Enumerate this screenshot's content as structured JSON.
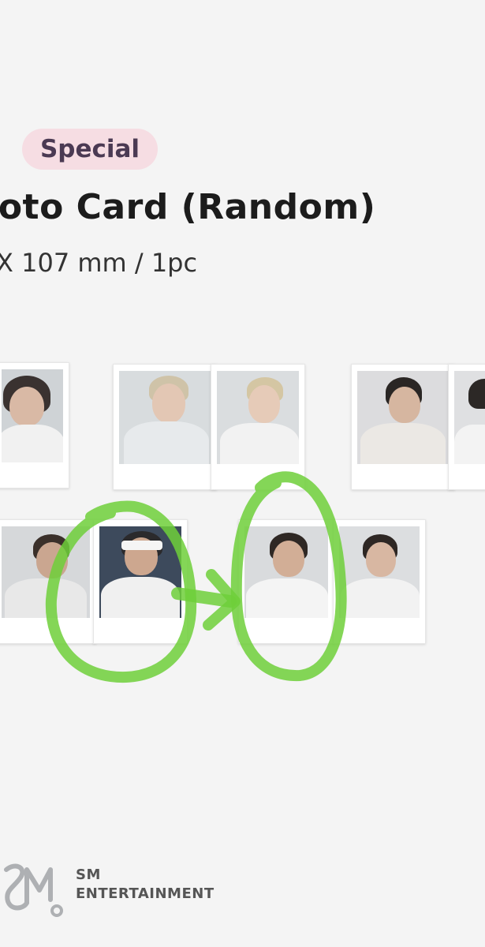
{
  "header": {
    "badge": "Special",
    "title": "hoto Card (Random)",
    "spec": "X 107 mm / 1pc"
  },
  "footer": {
    "brand_line1": "SM",
    "brand_line2": "ENTERTAINMENT"
  },
  "colors": {
    "badge_bg": "#f6dde3",
    "badge_text": "#4b3a53",
    "highlight_marker": "#6fcf3a"
  }
}
